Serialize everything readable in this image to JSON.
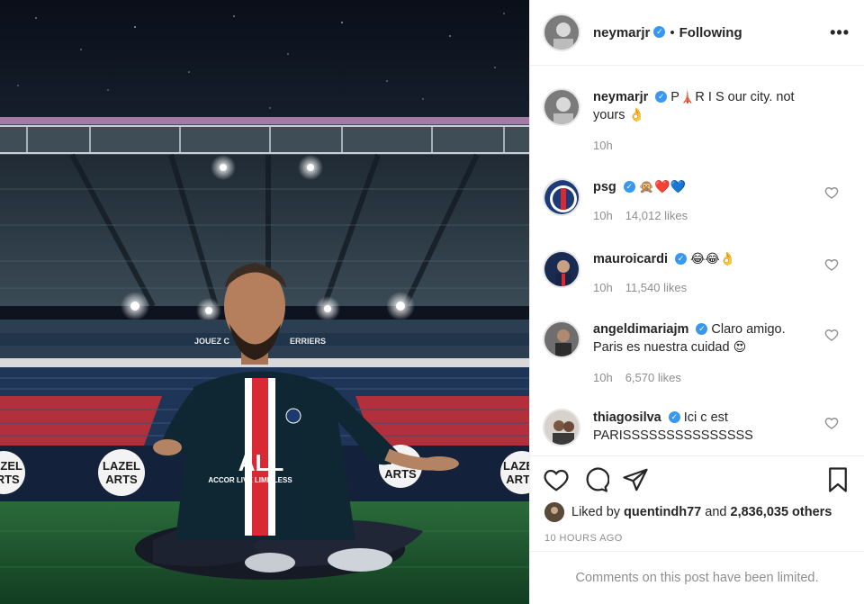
{
  "post": {
    "username": "neymarjr",
    "follow_state": "Following",
    "separator": "•",
    "more_icon": "more-options-icon",
    "verified_mark": "✓"
  },
  "photo": {
    "banner_left": "JOUEZ C",
    "banner_right": "ERRIERS",
    "board_text": "LAZEL\nARTS",
    "board_texts": [
      "LAZEL",
      "ARTS"
    ],
    "shirt_brand": "ALL",
    "shirt_sub": "ACCOR LIVE LIMITLESS"
  },
  "comments": [
    {
      "username": "neymarjr",
      "text": "P🗼R I S our city. not yours 👌",
      "text_a": "P",
      "text_b": "R I S our city. not",
      "text_c": "yours",
      "time": "10h",
      "likes": ""
    },
    {
      "username": "psg",
      "text": "🙊❤️💙",
      "time": "10h",
      "likes": "14,012 likes"
    },
    {
      "username": "mauroicardi",
      "text": "😂😂👌",
      "time": "10h",
      "likes": "11,540 likes"
    },
    {
      "username": "angeldimariajm",
      "text_a": "Claro amigo.",
      "text_b": "Paris es nuestra cuidad",
      "emoji": "😍",
      "time": "10h",
      "likes": "6,570 likes"
    },
    {
      "username": "thiagosilva",
      "text_a": "Ici c est",
      "text_b": "PARISSSSSSSSSSSSSSS"
    }
  ],
  "likes": {
    "prefix": "Liked by",
    "user": "quentindh77",
    "conj": "and",
    "count": "2,836,035 others"
  },
  "timestamp": "10 HOURS AGO",
  "limited": "Comments on this post have been limited.",
  "colors": {
    "verified": "#3897f0",
    "muted": "#8e8e8e",
    "heart_red": "#e0103a",
    "heart_blue": "#3ab4f2"
  }
}
